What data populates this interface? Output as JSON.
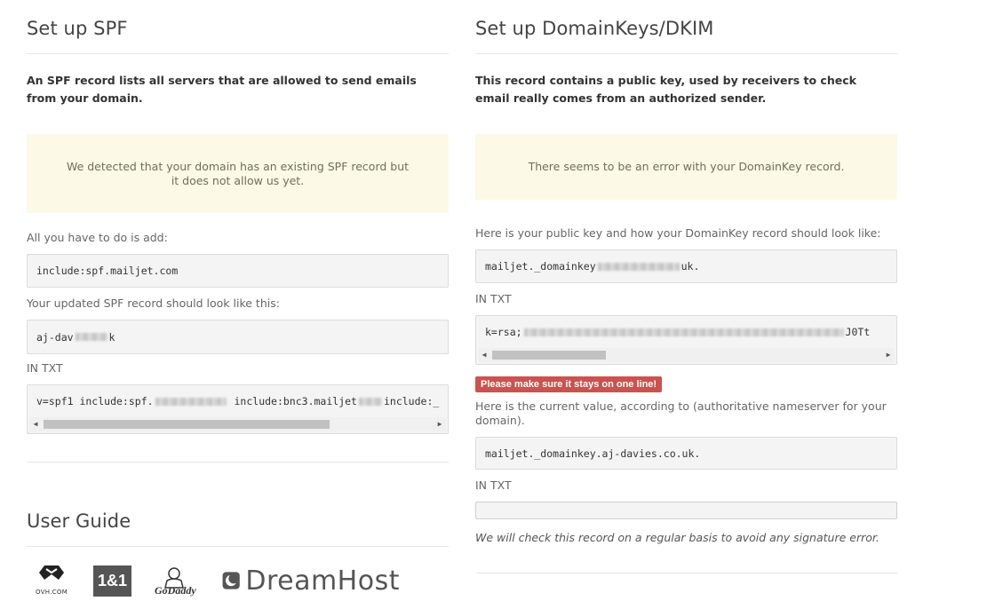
{
  "spf": {
    "title": "Set up SPF",
    "lead": "An SPF record lists all servers that are allowed to send emails from your domain.",
    "notice": "We detected that your domain has an existing SPF record but it does not allow us yet.",
    "add_label": "All you have to do is add:",
    "add_value": "include:spf.mailjet.com",
    "updated_label": "Your updated SPF record should look like this:",
    "host_value": "aj-dav",
    "host_suffix": "k",
    "in_txt": "IN TXT",
    "txt_value_1": "v=spf1 include:spf.",
    "txt_value_2": "include:bnc3.mailjet",
    "txt_value_3": "include:_"
  },
  "dkim": {
    "title": "Set up DomainKeys/DKIM",
    "lead": "This record contains a public key, used by receivers to check email really comes from an authorized sender.",
    "notice": "There seems to be an error with your DomainKey record.",
    "pubkey_label": "Here is your public key and how your DomainKey record should look like:",
    "host_value": "mailjet._domainkey",
    "host_suffix": "uk.",
    "in_txt": "IN TXT",
    "txt_value_start": "k=rsa;",
    "txt_value_end": "J0Tt",
    "error_badge": "Please make sure it stays on one line!",
    "current_label": "Here is the current value, according to (authoritative nameserver for your domain).",
    "current_value": "mailjet._domainkey.aj-davies.co.uk.",
    "in_txt_2": "IN TXT",
    "check_note": "We will check this record on a regular basis to avoid any signature error."
  },
  "guide": {
    "title": "User Guide",
    "logos": [
      "OVH.com",
      "1&1",
      "GoDaddy",
      "DreamHost"
    ],
    "logo_text_ovh": "OVH.COM",
    "logo_text_1and1": "1&1",
    "logo_text_godaddy": "GoDaddy",
    "logo_text_dreamhost": "DreamHost"
  },
  "colors": {
    "notice_bg": "#fcfae6",
    "error_badge": "#c9534f",
    "code_bg": "#f4f4f4"
  }
}
